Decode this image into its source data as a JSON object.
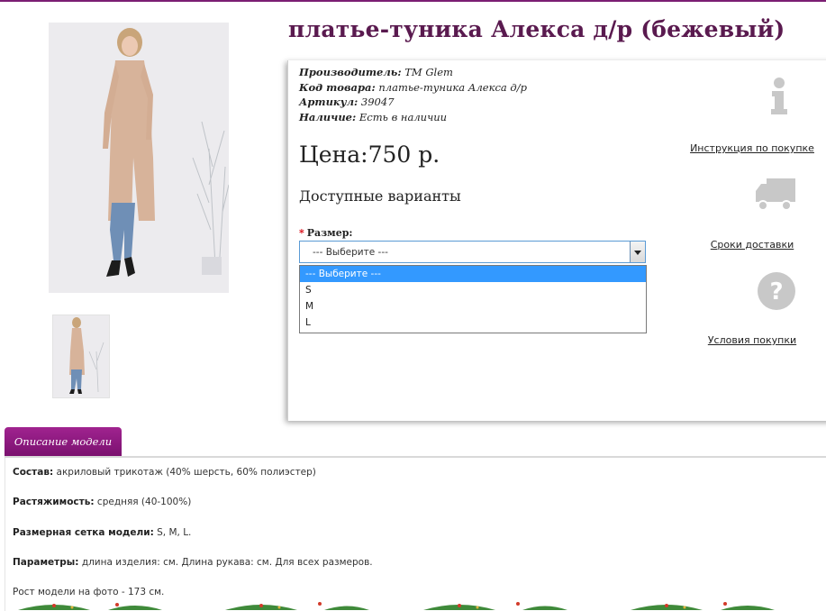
{
  "product": {
    "title": "платье-туника Алекса д/р (бежевый)",
    "meta": [
      {
        "label": "Производитель:",
        "value": "TM Glem"
      },
      {
        "label": "Код товара:",
        "value": "платье-туника Алекса д/р"
      },
      {
        "label": "Артикул:",
        "value": "39047"
      },
      {
        "label": "Наличие:",
        "value": "Есть в наличии"
      }
    ],
    "price": "Цена:750 р.",
    "variants_heading": "Доступные варианты",
    "size_label": "Размер:",
    "size_select": {
      "selected": "--- Выберите ---",
      "options": [
        "--- Выберите ---",
        "S",
        "M",
        "L"
      ]
    }
  },
  "info_links": [
    {
      "label": "Инструкция по покупке",
      "icon": "info-icon"
    },
    {
      "label": "Сроки доставки",
      "icon": "truck-icon"
    },
    {
      "label": "Условия покупки",
      "icon": "question-icon"
    }
  ],
  "tabs": [
    {
      "label": "Описание модели"
    }
  ],
  "description": [
    {
      "label": "Состав:",
      "text": " акриловый трикотаж (40% шерсть, 60% полиэстер)"
    },
    {
      "label": "Растяжимость:",
      "text": " средняя (40-100%)"
    },
    {
      "label": "Размерная сетка модели:",
      "text": " S, M, L."
    },
    {
      "label": "Параметры:",
      "text": " длина изделия: см. Длина рукава: см. Для всех размеров."
    },
    {
      "label": "",
      "text": "Рост модели на фото - 173 см."
    }
  ],
  "colors": {
    "accent": "#7b1e73",
    "title": "#5a1a4f",
    "dropdown_highlight": "#3399ff",
    "icon_grey": "#c8c8c8"
  }
}
